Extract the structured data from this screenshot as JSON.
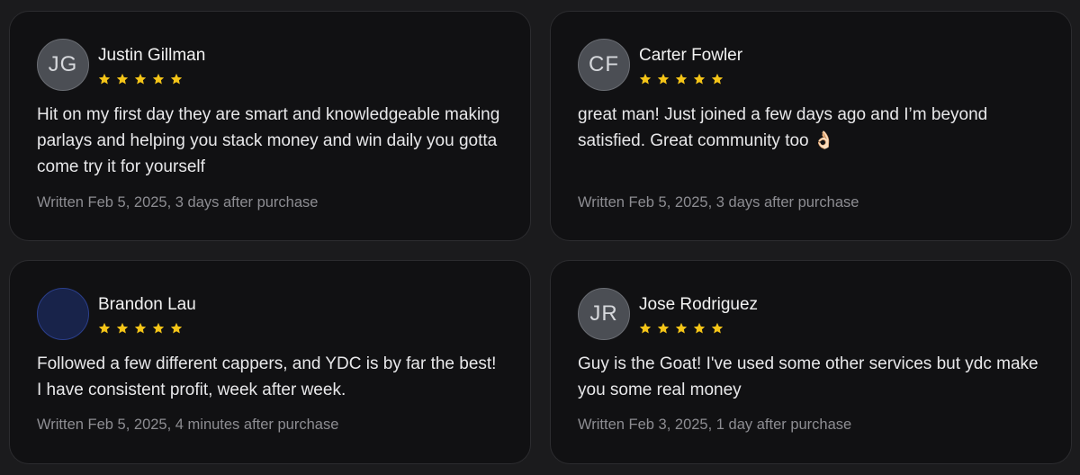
{
  "colors": {
    "background": "#1b1b1d",
    "card": "#111113",
    "star": "#f5c518",
    "meta_text": "#8d8d92"
  },
  "reviews": [
    {
      "initials": "JG",
      "name": "Justin Gillman",
      "rating": 5,
      "text": "Hit on my first day they are smart and knowledgeable making parlays and helping you stack money and win daily you gotta come try it for yourself",
      "meta": "Written Feb 5, 2025, 3 days after purchase"
    },
    {
      "initials": "CF",
      "name": "Carter Fowler",
      "rating": 5,
      "text": "great man! Just joined a few days ago and I’m beyond satisfied. Great community too 👌🏻",
      "meta": "Written Feb 5, 2025, 3 days after purchase"
    },
    {
      "initials": "",
      "name": "Brandon Lau",
      "rating": 5,
      "text": "Followed a few different cappers, and YDC is by far the best! I have consistent profit, week after week.",
      "meta": "Written Feb 5, 2025, 4 minutes after purchase"
    },
    {
      "initials": "JR",
      "name": "Jose Rodriguez",
      "rating": 5,
      "text": "Guy is the Goat! I've used some other services but ydc make you some real money",
      "meta": "Written Feb 3, 2025, 1 day after purchase"
    }
  ]
}
